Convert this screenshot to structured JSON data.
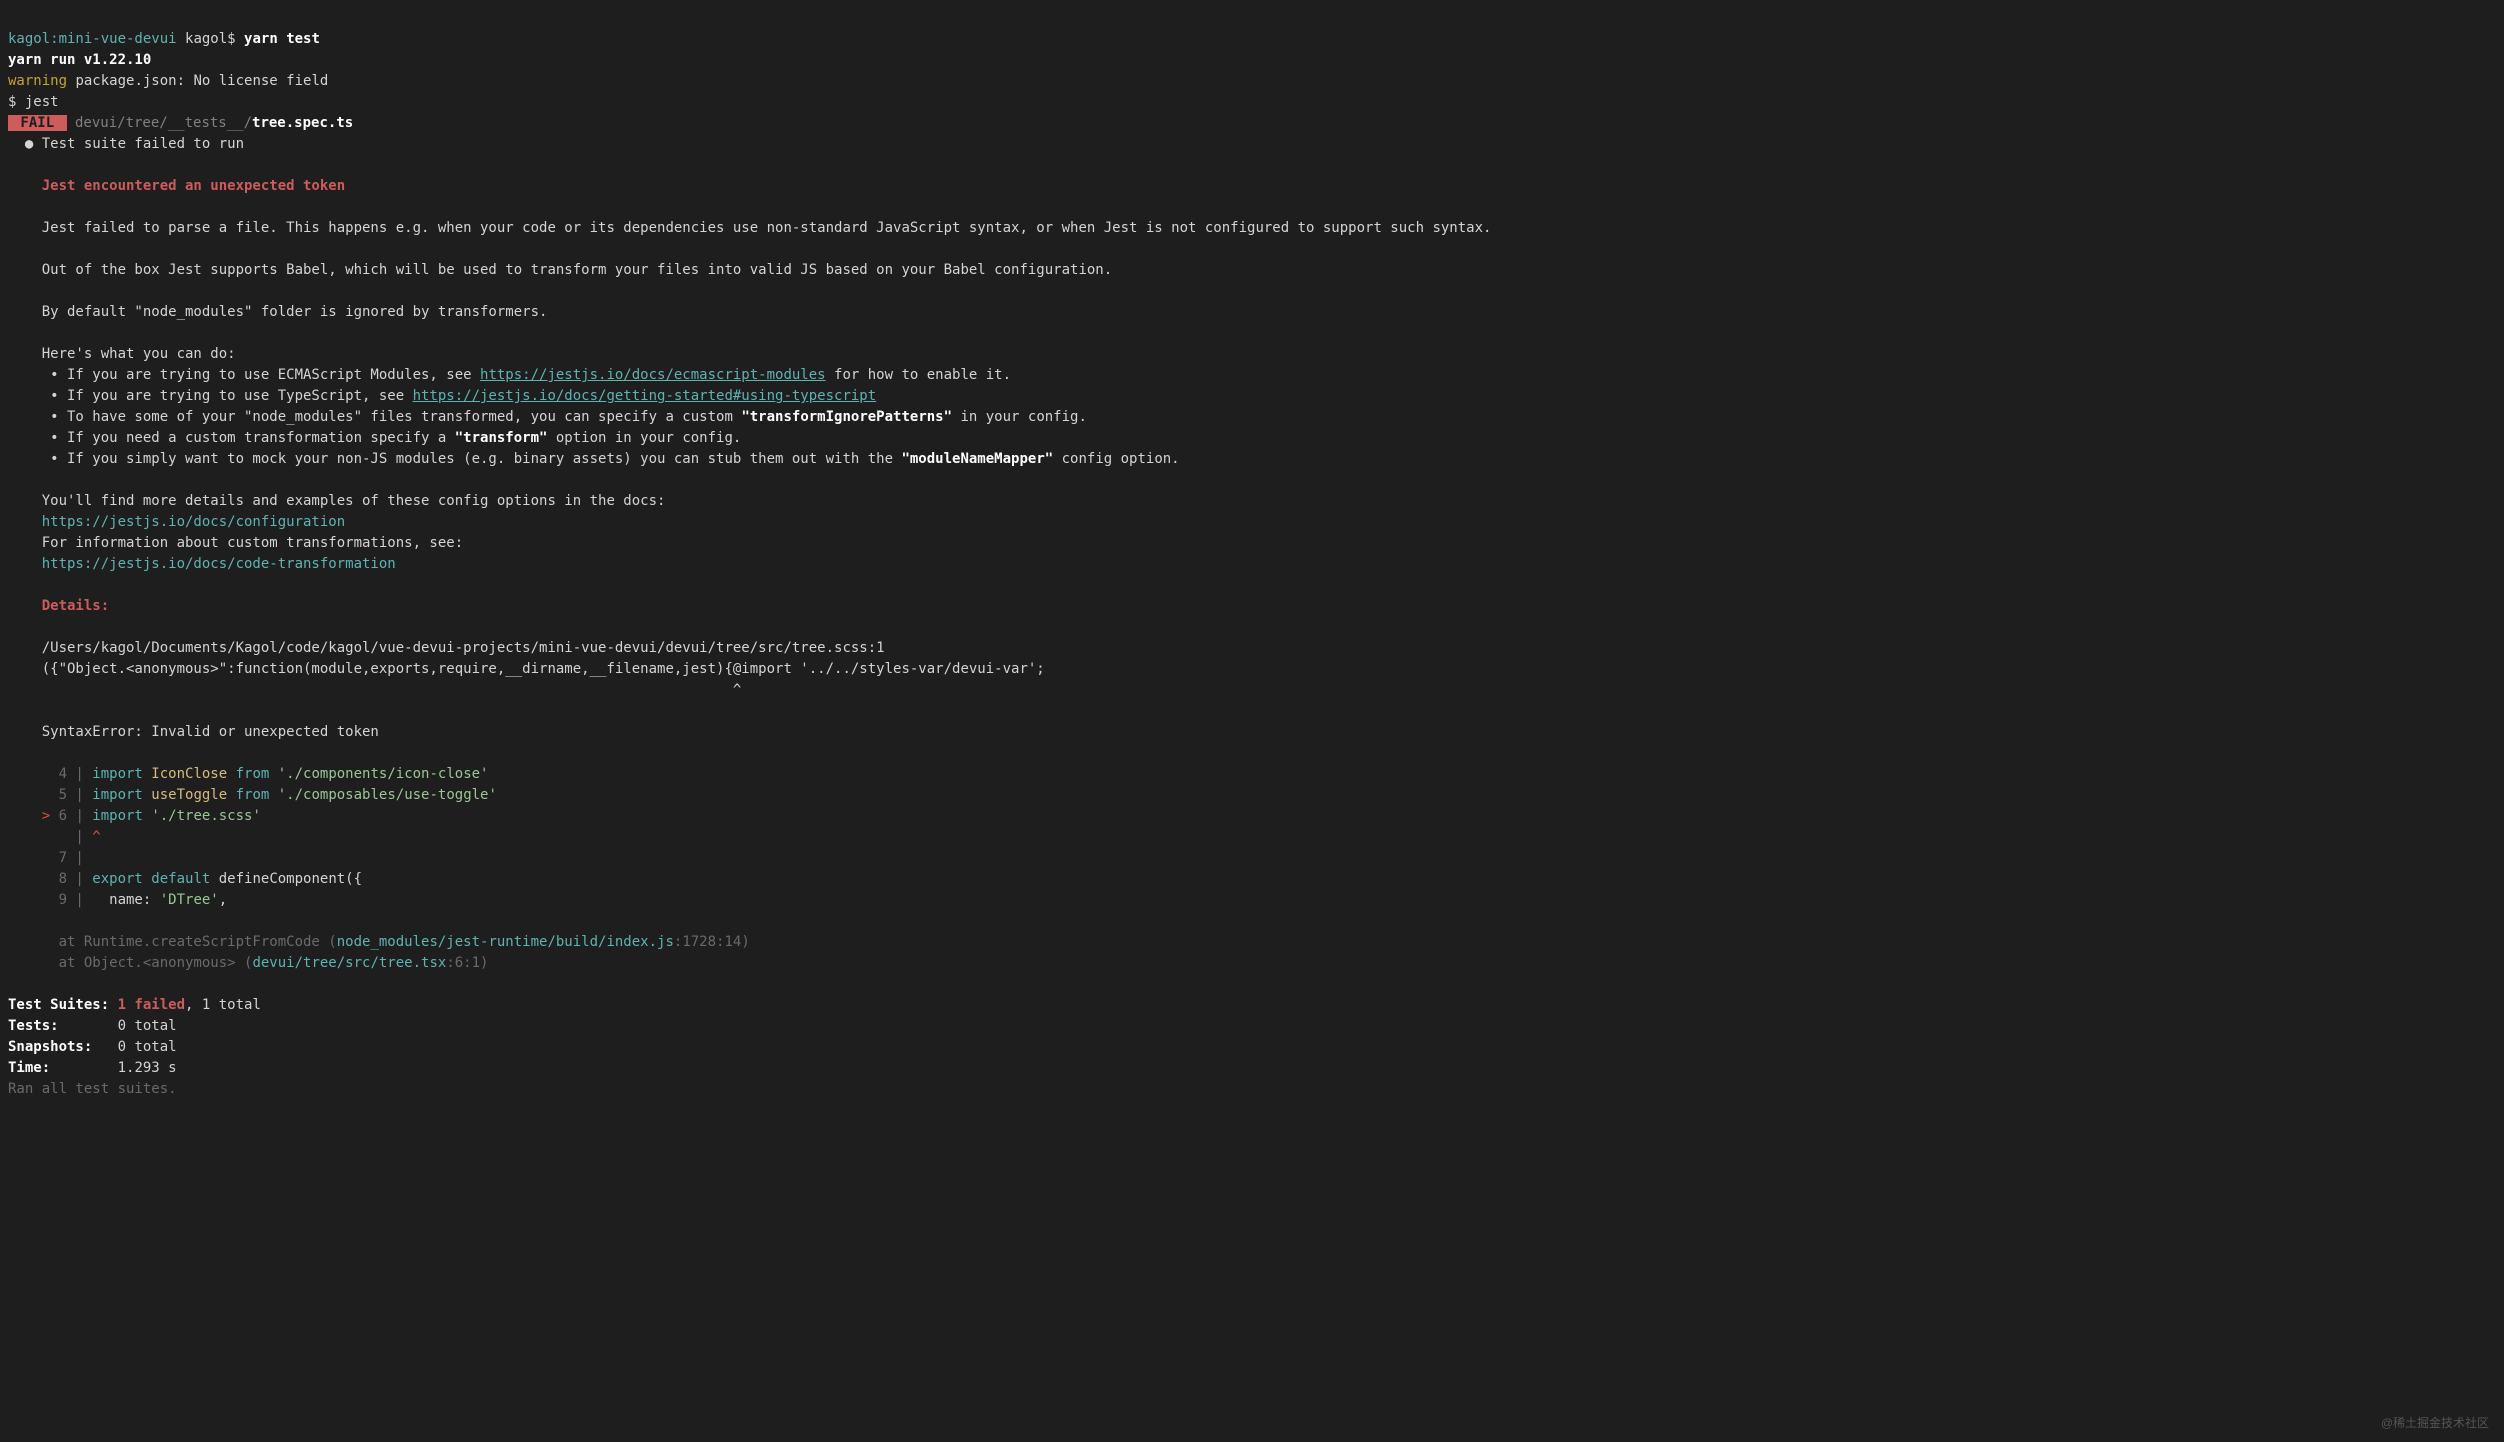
{
  "prompt": {
    "path": "kagol:mini-vue-devui",
    "user": "kagol",
    "dollar": "$",
    "command": "yarn test"
  },
  "yarn_run": "yarn run v1.22.10",
  "warning": "warning",
  "warning_msg": " package.json: No license field",
  "jest_cmd": "$ jest",
  "fail_badge": " FAIL ",
  "test_path_grey": " devui/tree/__tests__/",
  "test_path_white": "tree.spec.ts",
  "bullet_line": "  ● Test suite failed to run",
  "error_title": "    Jest encountered an unexpected token",
  "error_p1": "    Jest failed to parse a file. This happens e.g. when your code or its dependencies use non-standard JavaScript syntax, or when Jest is not configured to support such syntax.",
  "error_p2": "    Out of the box Jest supports Babel, which will be used to transform your files into valid JS based on your Babel configuration.",
  "error_p3": "    By default \"node_modules\" folder is ignored by transformers.",
  "heres_what": "    Here's what you can do:",
  "b1_pre": "     • If you are trying to use ECMAScript Modules, see ",
  "b1_link": "https://jestjs.io/docs/ecmascript-modules",
  "b1_post": " for how to enable it.",
  "b2_pre": "     • If you are trying to use TypeScript, see ",
  "b2_link": "https://jestjs.io/docs/getting-started#using-typescript",
  "b3_pre": "     • To have some of your \"node_modules\" files transformed, you can specify a custom ",
  "b3_bold": "\"transformIgnorePatterns\"",
  "b3_post": " in your config.",
  "b4_pre": "     • If you need a custom transformation specify a ",
  "b4_bold": "\"transform\"",
  "b4_post": " option in your config.",
  "b5_pre": "     • If you simply want to mock your non-JS modules (e.g. binary assets) you can stub them out with the ",
  "b5_bold": "\"moduleNameMapper\"",
  "b5_post": " config option.",
  "docs_intro": "    You'll find more details and examples of these config options in the docs:",
  "docs_link1": "    https://jestjs.io/docs/configuration",
  "docs_custom": "    For information about custom transformations, see:",
  "docs_link2": "    https://jestjs.io/docs/code-transformation",
  "details": "    Details:",
  "file_err": "    /Users/kagol/Documents/Kagol/code/kagol/vue-devui-projects/mini-vue-devui/devui/tree/src/tree.scss:1",
  "obj_line": "    ({\"Object.<anonymous>\":function(module,exports,require,__dirname,__filename,jest){@import '../../styles-var/devui-var';",
  "caret_line": "                                                                                      ^",
  "syntax_err": "    SyntaxError: Invalid or unexpected token",
  "code": {
    "l4_num": "      4 |",
    "l4_import": " import",
    "l4_name": " IconClose",
    "l4_from": " from",
    "l4_path": " './components/icon-close'",
    "l5_num": "      5 |",
    "l5_import": " import",
    "l5_name": " useToggle",
    "l5_from": " from",
    "l5_path": " './composables/use-toggle'",
    "l6_arrow": "    >",
    "l6_num": " 6 |",
    "l6_import": " import",
    "l6_path": " './tree.scss'",
    "l6_caret": "        | ",
    "l6_caret_sym": "^",
    "l7_num": "      7 |",
    "l8_num": "      8 |",
    "l8_export": " export",
    "l8_default": " default",
    "l8_func": " defineComponent({",
    "l9_num": "      9 |",
    "l9_name": "   name:",
    "l9_val": " 'DTree'",
    "l9_comma": ","
  },
  "stack1_pre": "      at Runtime.createScriptFromCode (",
  "stack1_path": "node_modules/jest-runtime/build/index.js",
  "stack1_loc": ":1728:14)",
  "stack2_pre": "      at Object.<anonymous> (",
  "stack2_path": "devui/tree/src/tree.tsx",
  "stack2_loc": ":6:1)",
  "summary": {
    "suites_label": "Test Suites:",
    "suites_failed": " 1 failed",
    "suites_rest": ", 1 total",
    "tests_label": "Tests:      ",
    "tests_val": " 0 total",
    "snap_label": "Snapshots:  ",
    "snap_val": " 0 total",
    "time_label": "Time:       ",
    "time_val": " 1.293 s",
    "ran": "Ran all test suites."
  },
  "watermark": "@稀土掘金技术社区"
}
